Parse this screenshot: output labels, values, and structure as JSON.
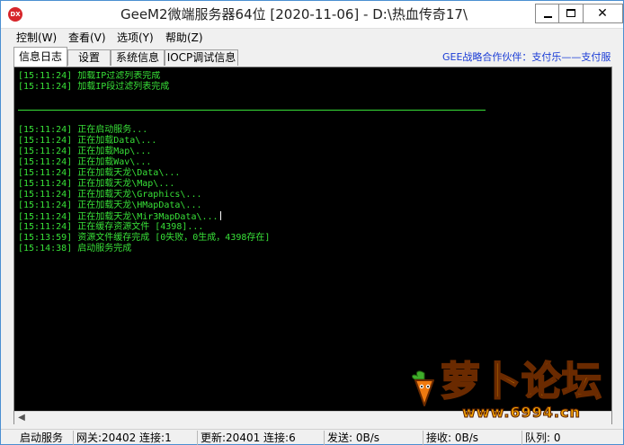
{
  "window": {
    "icon_text": "DX",
    "title": "GeeM2微端服务器64位 [2020-11-06] - D:\\热血传奇17\\",
    "close_glyph": "✕"
  },
  "menu": {
    "items": [
      {
        "label": "控制(W)"
      },
      {
        "label": "查看(V)"
      },
      {
        "label": "选项(Y)"
      },
      {
        "label": "帮助(Z)"
      }
    ]
  },
  "tabs": {
    "items": [
      {
        "label": "信息日志",
        "active": true
      },
      {
        "label": "设置",
        "active": false
      },
      {
        "label": "系统信息",
        "active": false
      },
      {
        "label": "IOCP调试信息",
        "active": false
      }
    ],
    "partner_text": "GEE战略合作伙伴：支付乐——支付服"
  },
  "log": {
    "lines": [
      "[15:11:24] 加载IP过滤列表完成",
      "[15:11:24] 加载IP段过滤列表完成",
      "",
      "---",
      "",
      "[15:11:24] 正在启动服务...",
      "[15:11:24] 正在加载Data\\...",
      "[15:11:24] 正在加载Map\\...",
      "[15:11:24] 正在加载Wav\\...",
      "[15:11:24] 正在加载天龙\\Data\\...",
      "[15:11:24] 正在加载天龙\\Map\\...",
      "[15:11:24] 正在加载天龙\\Graphics\\...",
      "[15:11:24] 正在加载天龙\\HMapData\\...",
      "[15:11:24] 正在加载天龙\\Mir3MapData\\...",
      "[15:11:24] 正在缓存资源文件 [4398]...",
      "[15:13:59] 资源文件缓存完成 [0失败，0生成，4398存在]",
      "[15:14:38] 启动服务完成"
    ]
  },
  "watermark": {
    "text": "萝卜论坛",
    "site": "www.6994.cn"
  },
  "status": {
    "cells": [
      {
        "text": "启动服务"
      },
      {
        "text": "网关:20402  连接:1"
      },
      {
        "text": "更新:20401  连接:6"
      },
      {
        "text": "发送: 0B/s"
      },
      {
        "text": "接收: 0B/s"
      },
      {
        "text": "队列: 0"
      }
    ]
  },
  "colors": {
    "log_text": "#38e038",
    "log_bg": "#000000",
    "partner_link": "#1a3cd6",
    "watermark": "#f5a300"
  }
}
